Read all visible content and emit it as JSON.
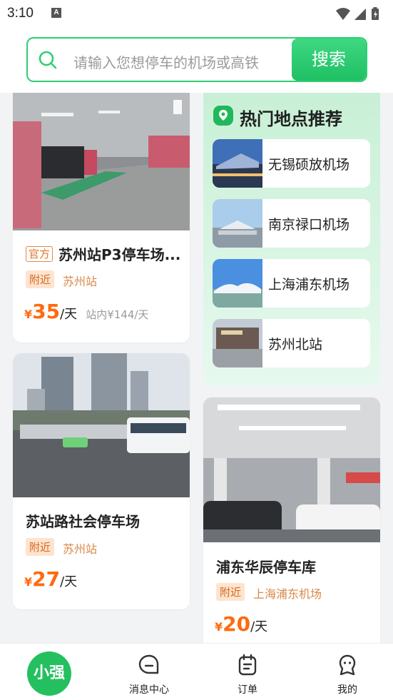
{
  "status_bar": {
    "time": "3:10",
    "notification_icon": "A"
  },
  "search": {
    "placeholder": "请输入您想停车的机场或高铁",
    "button_label": "搜索"
  },
  "parking_cards": [
    {
      "official_tag": "官方",
      "title": "苏州站P3停车场...",
      "near_tag": "附近",
      "near_place": "苏州站",
      "currency": "¥",
      "price": "35",
      "unit": "/天",
      "original_price": "站内¥144/天"
    },
    {
      "title": "苏站路社会停车场",
      "near_tag": "附近",
      "near_place": "苏州站",
      "currency": "¥",
      "price": "27",
      "unit": "/天"
    },
    {
      "title": "浦东华辰停车库",
      "near_tag": "附近",
      "near_place": "上海浦东机场",
      "currency": "¥",
      "price": "20",
      "unit": "/天"
    }
  ],
  "hot_places": {
    "title": "热门地点推荐",
    "items": [
      {
        "label": "无锡硕放机场"
      },
      {
        "label": "南京禄口机场"
      },
      {
        "label": "上海浦东机场"
      },
      {
        "label": "苏州北站"
      }
    ]
  },
  "tab_bar": {
    "home_label": "小强",
    "items": [
      {
        "label": "消息中心",
        "icon": "message-icon"
      },
      {
        "label": "订单",
        "icon": "order-icon"
      },
      {
        "label": "我的",
        "icon": "profile-icon"
      }
    ]
  },
  "colors": {
    "accent": "#2fce73",
    "price": "#ff6a10",
    "tag_bg": "#fde4cf",
    "tag_text": "#d9661f"
  }
}
